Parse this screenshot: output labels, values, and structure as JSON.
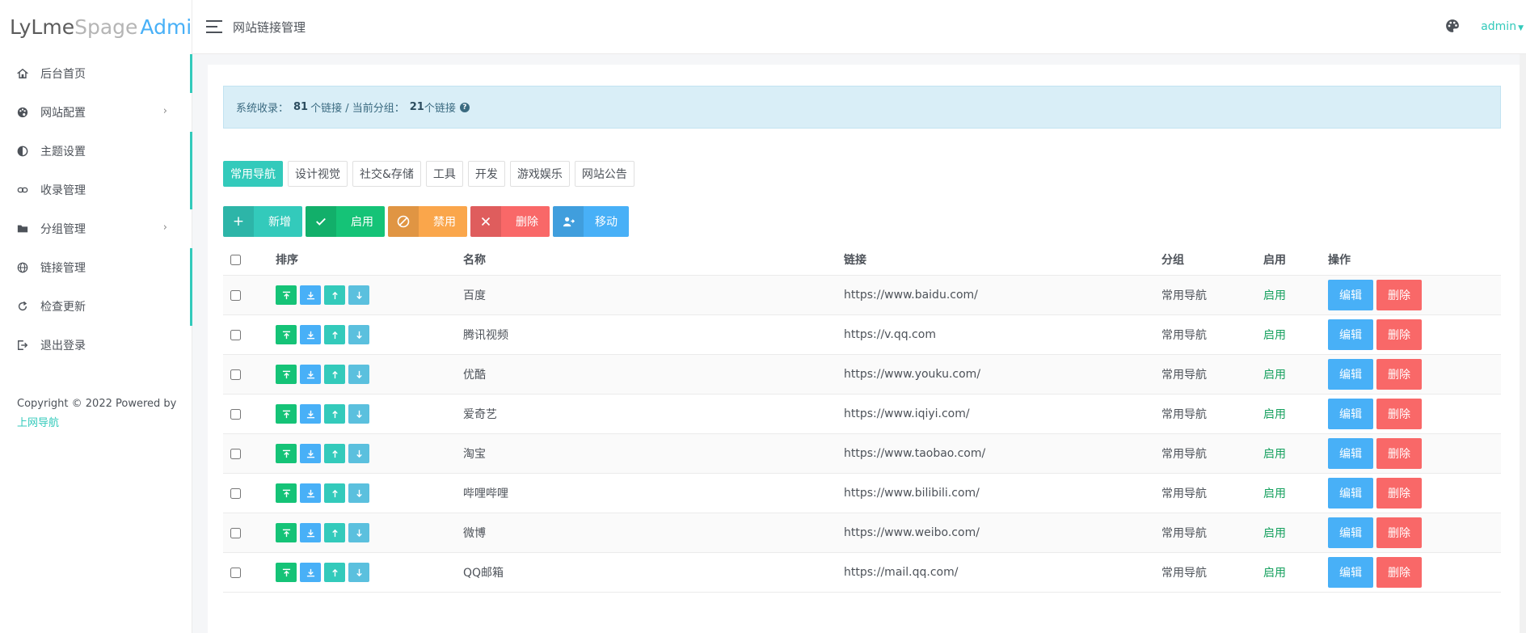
{
  "logo": {
    "part1": "LyLme",
    "part2": "Spage",
    "part3": "Admin"
  },
  "sidebar": {
    "items": [
      {
        "label": "后台首页",
        "icon": "home-icon"
      },
      {
        "label": "网站配置",
        "icon": "palette-icon"
      },
      {
        "label": "主题设置",
        "icon": "contrast-icon"
      },
      {
        "label": "收录管理",
        "icon": "link-icon"
      },
      {
        "label": "分组管理",
        "icon": "folder-icon"
      },
      {
        "label": "链接管理",
        "icon": "globe-icon"
      },
      {
        "label": "检查更新",
        "icon": "refresh-icon"
      },
      {
        "label": "退出登录",
        "icon": "logout-icon"
      }
    ],
    "arrow": "›",
    "copyright_text": "Copyright © 2022 Powered by",
    "copyright_link": "上网导航"
  },
  "header": {
    "title": "网站链接管理",
    "user": "admin"
  },
  "alert": {
    "prefix": "系统收录：",
    "total": "81",
    "mid": "个链接 / 当前分组：",
    "group_count": "21",
    "suffix": "个链接"
  },
  "tabs": [
    "常用导航",
    "设计视觉",
    "社交&存储",
    "工具",
    "开发",
    "游戏娱乐",
    "网站公告"
  ],
  "toolbar": {
    "add": "新增",
    "enable": "启用",
    "disable": "禁用",
    "delete": "删除",
    "move": "移动"
  },
  "table": {
    "headers": {
      "sort": "排序",
      "name": "名称",
      "link": "链接",
      "group": "分组",
      "enabled": "启用",
      "ops": "操作"
    },
    "edit_label": "编辑",
    "delete_label": "删除",
    "rows": [
      {
        "name": "百度",
        "link": "https://www.baidu.com/",
        "group": "常用导航",
        "enabled": "启用"
      },
      {
        "name": "腾讯视频",
        "link": "https://v.qq.com",
        "group": "常用导航",
        "enabled": "启用"
      },
      {
        "name": "优酷",
        "link": "https://www.youku.com/",
        "group": "常用导航",
        "enabled": "启用"
      },
      {
        "name": "爱奇艺",
        "link": "https://www.iqiyi.com/",
        "group": "常用导航",
        "enabled": "启用"
      },
      {
        "name": "淘宝",
        "link": "https://www.taobao.com/",
        "group": "常用导航",
        "enabled": "启用"
      },
      {
        "name": "哔哩哔哩",
        "link": "https://www.bilibili.com/",
        "group": "常用导航",
        "enabled": "启用"
      },
      {
        "name": "微博",
        "link": "https://www.weibo.com/",
        "group": "常用导航",
        "enabled": "启用"
      },
      {
        "name": "QQ邮箱",
        "link": "https://mail.qq.com/",
        "group": "常用导航",
        "enabled": "启用"
      }
    ]
  }
}
